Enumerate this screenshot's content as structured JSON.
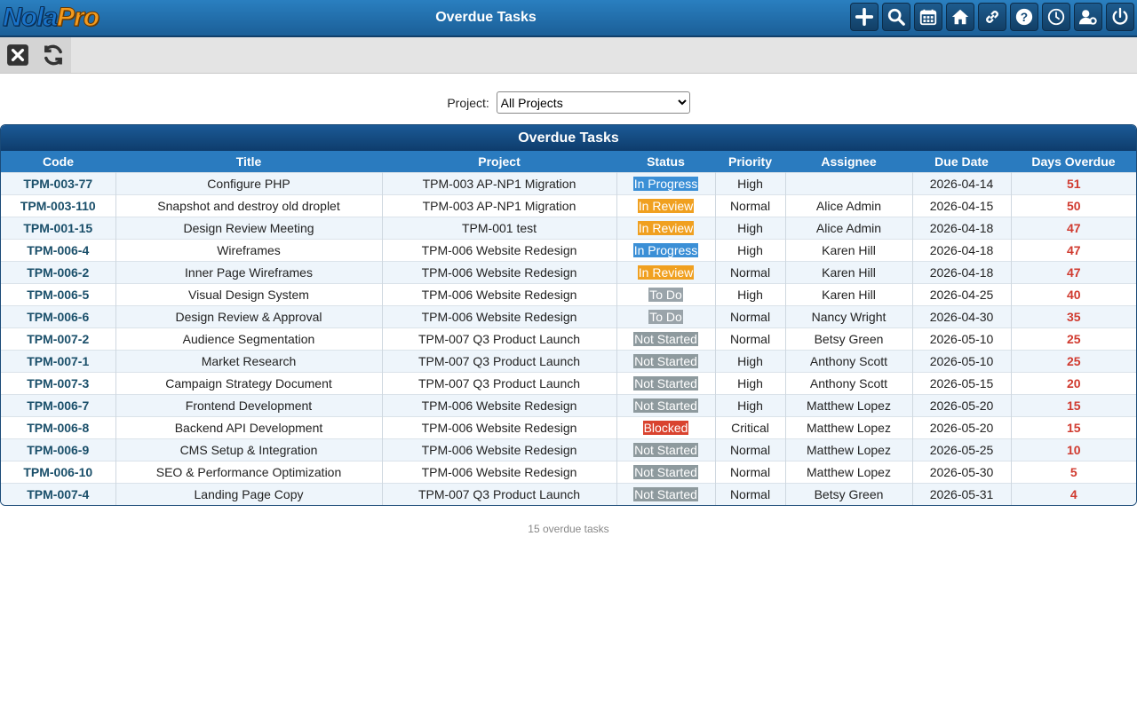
{
  "header": {
    "logo_first": "Nola",
    "logo_second": "Pro",
    "title": "Overdue Tasks",
    "icons": [
      "plus-icon",
      "search-icon",
      "calendar-icon",
      "home-icon",
      "link-icon",
      "help-icon",
      "clock-icon",
      "user-settings-icon",
      "power-icon"
    ]
  },
  "toolbar": {
    "icons": [
      "close-icon",
      "refresh-icon"
    ]
  },
  "filter": {
    "label": "Project:",
    "selected": "All Projects"
  },
  "panel": {
    "title": "Overdue Tasks"
  },
  "table": {
    "columns": [
      "Code",
      "Title",
      "Project",
      "Status",
      "Priority",
      "Assignee",
      "Due Date",
      "Days Overdue"
    ],
    "rows": [
      {
        "code": "TPM-003-77",
        "title": "Configure PHP",
        "project": "TPM-003 AP-NP1 Migration",
        "status": "In Progress",
        "priority": "High",
        "assignee": "",
        "due": "2026-04-14",
        "days": "51"
      },
      {
        "code": "TPM-003-110",
        "title": "Snapshot and destroy old droplet",
        "project": "TPM-003 AP-NP1 Migration",
        "status": "In Review",
        "priority": "Normal",
        "assignee": "Alice Admin",
        "due": "2026-04-15",
        "days": "50"
      },
      {
        "code": "TPM-001-15",
        "title": "Design Review Meeting",
        "project": "TPM-001 test",
        "status": "In Review",
        "priority": "High",
        "assignee": "Alice Admin",
        "due": "2026-04-18",
        "days": "47"
      },
      {
        "code": "TPM-006-4",
        "title": "Wireframes",
        "project": "TPM-006 Website Redesign",
        "status": "In Progress",
        "priority": "High",
        "assignee": "Karen Hill",
        "due": "2026-04-18",
        "days": "47"
      },
      {
        "code": "TPM-006-2",
        "title": "Inner Page Wireframes",
        "project": "TPM-006 Website Redesign",
        "status": "In Review",
        "priority": "Normal",
        "assignee": "Karen Hill",
        "due": "2026-04-18",
        "days": "47"
      },
      {
        "code": "TPM-006-5",
        "title": "Visual Design System",
        "project": "TPM-006 Website Redesign",
        "status": "To Do",
        "priority": "High",
        "assignee": "Karen Hill",
        "due": "2026-04-25",
        "days": "40"
      },
      {
        "code": "TPM-006-6",
        "title": "Design Review & Approval",
        "project": "TPM-006 Website Redesign",
        "status": "To Do",
        "priority": "Normal",
        "assignee": "Nancy Wright",
        "due": "2026-04-30",
        "days": "35"
      },
      {
        "code": "TPM-007-2",
        "title": "Audience Segmentation",
        "project": "TPM-007 Q3 Product Launch",
        "status": "Not Started",
        "priority": "Normal",
        "assignee": "Betsy Green",
        "due": "2026-05-10",
        "days": "25"
      },
      {
        "code": "TPM-007-1",
        "title": "Market Research",
        "project": "TPM-007 Q3 Product Launch",
        "status": "Not Started",
        "priority": "High",
        "assignee": "Anthony Scott",
        "due": "2026-05-10",
        "days": "25"
      },
      {
        "code": "TPM-007-3",
        "title": "Campaign Strategy Document",
        "project": "TPM-007 Q3 Product Launch",
        "status": "Not Started",
        "priority": "High",
        "assignee": "Anthony Scott",
        "due": "2026-05-15",
        "days": "20"
      },
      {
        "code": "TPM-006-7",
        "title": "Frontend Development",
        "project": "TPM-006 Website Redesign",
        "status": "Not Started",
        "priority": "High",
        "assignee": "Matthew Lopez",
        "due": "2026-05-20",
        "days": "15"
      },
      {
        "code": "TPM-006-8",
        "title": "Backend API Development",
        "project": "TPM-006 Website Redesign",
        "status": "Blocked",
        "priority": "Critical",
        "assignee": "Matthew Lopez",
        "due": "2026-05-20",
        "days": "15"
      },
      {
        "code": "TPM-006-9",
        "title": "CMS Setup & Integration",
        "project": "TPM-006 Website Redesign",
        "status": "Not Started",
        "priority": "Normal",
        "assignee": "Matthew Lopez",
        "due": "2026-05-25",
        "days": "10"
      },
      {
        "code": "TPM-006-10",
        "title": "SEO & Performance Optimization",
        "project": "TPM-006 Website Redesign",
        "status": "Not Started",
        "priority": "Normal",
        "assignee": "Matthew Lopez",
        "due": "2026-05-30",
        "days": "5"
      },
      {
        "code": "TPM-007-4",
        "title": "Landing Page Copy",
        "project": "TPM-007 Q3 Product Launch",
        "status": "Not Started",
        "priority": "Normal",
        "assignee": "Betsy Green",
        "due": "2026-05-31",
        "days": "4"
      }
    ]
  },
  "status_colors": {
    "In Progress": "#3b8fd6",
    "In Review": "#f0a020",
    "To Do": "#9aa4aa",
    "Not Started": "#8e9a9e",
    "Blocked": "#d9432f"
  },
  "footer": {
    "count_text": "15 overdue tasks"
  }
}
